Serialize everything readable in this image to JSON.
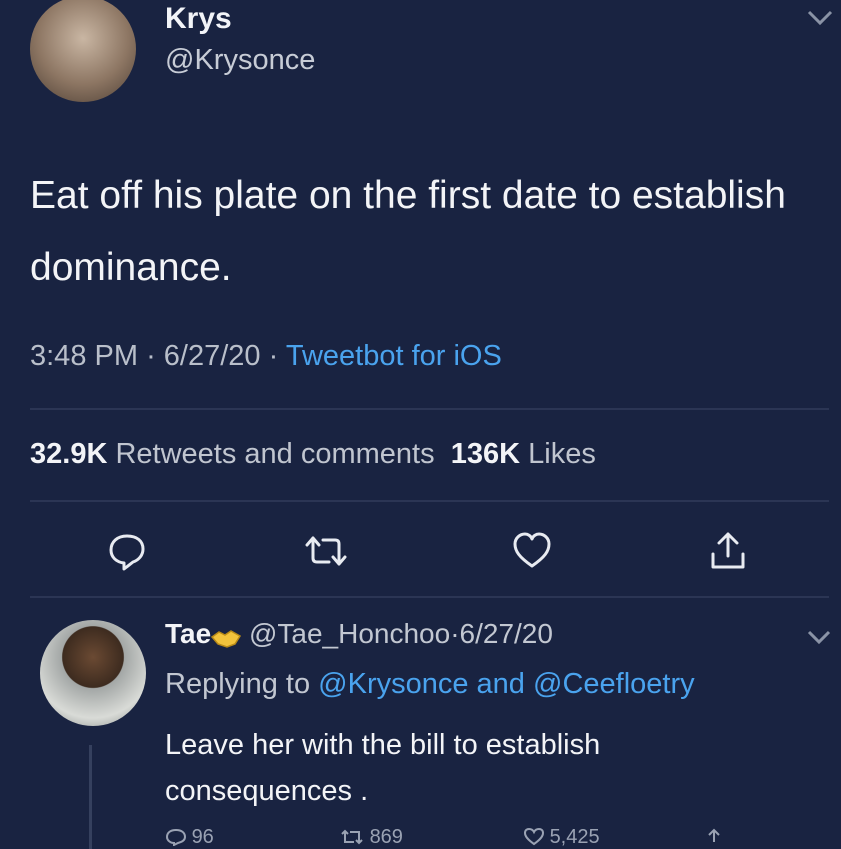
{
  "tweet": {
    "name": "Krys",
    "handle": "@Krysonce",
    "text": "Eat off his plate on the first date to establish dominance.",
    "time": "3:48 PM",
    "date": "6/27/20",
    "client": "Tweetbot for iOS",
    "retweets_count": "32.9K",
    "retweets_label": "Retweets and comments",
    "likes_count": "136K",
    "likes_label": "Likes",
    "sep": "·"
  },
  "reply": {
    "name": "Tae",
    "handle": "@Tae_Honchoo",
    "date": "6/27/20",
    "replying_prefix": "Replying to",
    "mention1": "@Krysonce",
    "and": "and",
    "mention2": "@Ceefloetry",
    "text": "Leave her with the bill to establish consequences .",
    "replies_count": "96",
    "retweets_count": "869",
    "likes_count": "5,425",
    "sep": "·"
  },
  "colors": {
    "background": "#192341",
    "link": "#4aa3ee",
    "divider": "#2b3554"
  },
  "icons": {
    "reply": "reply-icon",
    "retweet": "retweet-icon",
    "like": "heart-icon",
    "share": "share-icon",
    "menu": "chevron-down-icon",
    "emoji": "handshake-emoji"
  }
}
